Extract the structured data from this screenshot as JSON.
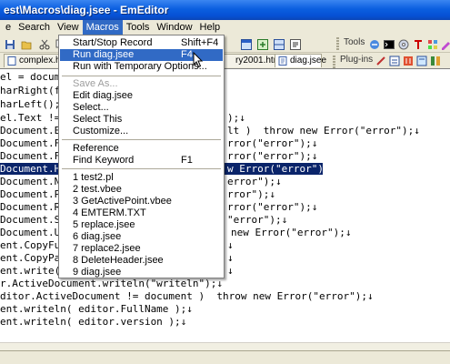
{
  "window": {
    "title": "est\\Macros\\diag.jsee - EmEditor"
  },
  "menubar": [
    {
      "label": "e",
      "underline": ""
    },
    {
      "label": "Search",
      "underline": ""
    },
    {
      "label": "View",
      "underline": ""
    },
    {
      "label": "Macros",
      "underline": ""
    },
    {
      "label": "Tools",
      "underline": ""
    },
    {
      "label": "Window",
      "underline": ""
    },
    {
      "label": "Help",
      "underline": ""
    }
  ],
  "toolbar": {
    "tools_label": "Tools",
    "plugins_label": "Plug-ins"
  },
  "tabs": [
    {
      "label": "complex.htr"
    },
    {
      "label": "ry2001.htm"
    },
    {
      "label": "diag.jsee"
    }
  ],
  "macros_menu": {
    "group1": [
      {
        "label": "Start/Stop Record",
        "shortcut": "Shift+F4"
      },
      {
        "label": "Run diag.jsee",
        "shortcut": "F4"
      },
      {
        "label": "Run with Temporary Options...",
        "shortcut": ""
      }
    ],
    "group2": [
      {
        "label": "Save As...",
        "shortcut": ""
      },
      {
        "label": "Edit diag.jsee",
        "shortcut": ""
      },
      {
        "label": "Select...",
        "shortcut": ""
      },
      {
        "label": "Select This",
        "shortcut": ""
      },
      {
        "label": "Customize...",
        "shortcut": ""
      }
    ],
    "group3": [
      {
        "label": "Reference",
        "shortcut": ""
      },
      {
        "label": "Find Keyword",
        "shortcut": "F1"
      }
    ],
    "recent": [
      "1 test2.pl",
      "2 test.vbee",
      "3 GetActivePoint.vbee",
      "4 EMTERM.TXT",
      "5 replace.jsee",
      "6 diag.jsee",
      "7 replace2.jsee",
      "8 DeleteHeader.jsee",
      "9 diag.jsee"
    ]
  },
  "code": {
    "l1": "el = docume",
    "l2": "harRight(fa",
    "l3": "harLeft();↓",
    "l4a": "el.Text !=",
    "l4b": ");↓",
    "l5a": "Document.Enc",
    "l5b": "lt )  throw new Error(\"error\");↓",
    "l6a": "Document.Fon",
    "l6b": "rror(\"error\");↓",
    "l7a": "Document.Ful",
    "l7b": "rror(\"error\");↓",
    "l8a": "Document.Hig",
    "l8b": "w Error(\"error\");↓",
    "l9a": "Document.Nam",
    "l9b": "error\");↓",
    "l10a": "Document.Pat",
    "l10b": "rror\");↓",
    "l11a": "Document.Rea",
    "l11b": "rror(\"error\");↓",
    "l12a": "Document.Sav",
    "l12b": "\"error\");↓",
    "l13a": "Document.Uni",
    "l13b": "new Error(\"error\");↓",
    "l14a": "ent.CopyFul",
    "l14b": "↓",
    "l15a": "ent.CopyPat",
    "l15b": "↓",
    "l16a": "ent.write(\"",
    "l16b": "↓",
    "l17": "r.ActiveDocument.writeln(\"writeln\");↓",
    "l18": "ditor.ActiveDocument != document )  throw new Error(\"error\");↓",
    "l19": "ent.writeln( editor.FullName );↓",
    "l20": "ent.writeln( editor.version );↓"
  },
  "colors": {
    "accent": "#316ac5",
    "titlebar": "#0650d4",
    "selection": "#0a246a"
  }
}
